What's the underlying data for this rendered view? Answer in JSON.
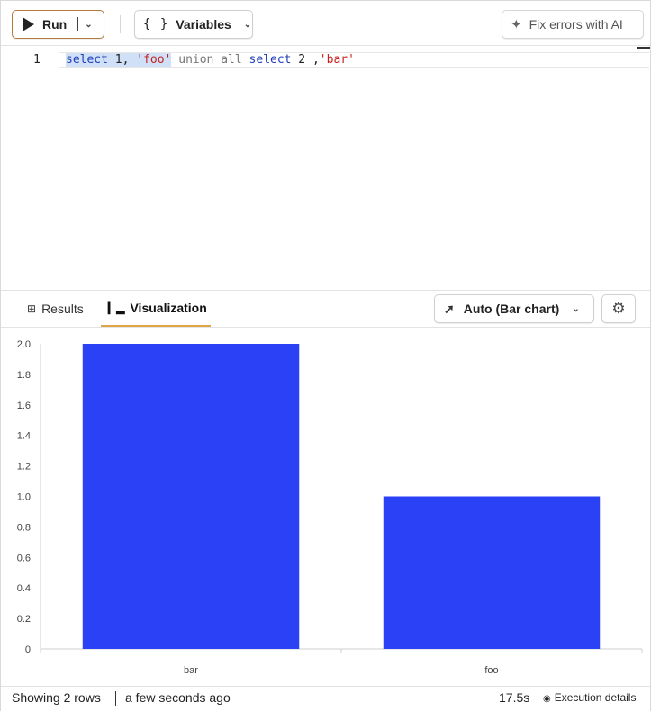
{
  "toolbar": {
    "run_label": "Run",
    "variables_label": "Variables",
    "variables_icon": "{ }",
    "fix_ai_label": "Fix errors with AI"
  },
  "editor": {
    "line_number": "1",
    "code": {
      "t1": "select",
      "t2": " 1, ",
      "t3": "'foo'",
      "t4": " union all ",
      "t5": "select",
      "t6": " 2 ,",
      "t7": "'bar'"
    }
  },
  "tabs": {
    "results_label": "Results",
    "visualization_label": "Visualization",
    "chart_type_label": "Auto (Bar chart)"
  },
  "chart_data": {
    "type": "bar",
    "categories": [
      "bar",
      "foo"
    ],
    "values": [
      2,
      1
    ],
    "ylim": [
      0,
      2
    ],
    "yticks": [
      "0",
      "0.2",
      "0.4",
      "0.6",
      "0.8",
      "1.0",
      "1.2",
      "1.4",
      "1.6",
      "1.8",
      "2.0"
    ],
    "bar_color": "#2a41f5",
    "grid": false
  },
  "status": {
    "rows_text": "Showing 2 rows",
    "time_text": "a few seconds ago",
    "duration": "17.5s",
    "execution_label": "Execution details"
  }
}
